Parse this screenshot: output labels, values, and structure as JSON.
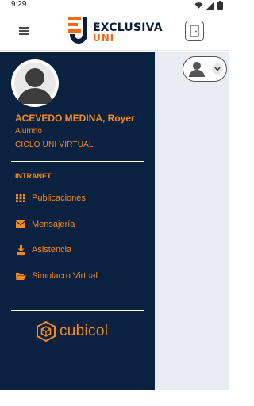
{
  "status_bar": {
    "time": "9:29",
    "icons": [
      "wifi-icon",
      "signal-icon",
      "battery-icon"
    ]
  },
  "app_bar": {
    "menu_icon": "hamburger-icon",
    "logo_text": "EXCLUSIVA",
    "logo_subtext": "UNI",
    "exit_icon": "door-icon"
  },
  "user_menu": {
    "icon": "user-icon",
    "chevron": "chevron-down-icon"
  },
  "sidebar": {
    "name": "ACEVEDO MEDINA, Royer",
    "role": "Alumno",
    "program": "CICLO UNI VIRTUAL",
    "section_title": "INTRANET",
    "items": [
      {
        "label": "Publicaciones",
        "icon": "grid-icon"
      },
      {
        "label": "Mensajería",
        "icon": "envelope-icon"
      },
      {
        "label": "Asistencia",
        "icon": "download-icon"
      },
      {
        "label": "Simulacro Virtual",
        "icon": "folder-open-icon"
      }
    ],
    "brand": "cubicol"
  },
  "colors": {
    "sidebar_bg": "#0b2140",
    "accent": "#f58a1f",
    "main_bg": "#e9ecf3"
  }
}
